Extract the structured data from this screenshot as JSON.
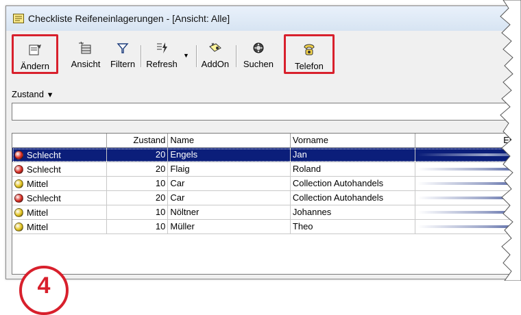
{
  "window": {
    "title": "Checkliste Reifeneinlagerungen  -  [Ansicht: Alle]"
  },
  "toolbar": {
    "aendern_label": "Ändern",
    "ansicht_label": "Ansicht",
    "filtern_label": "Filtern",
    "refresh_label": "Refresh",
    "addon_label": "AddOn",
    "suchen_label": "Suchen",
    "telefon_label": "Telefon"
  },
  "filter": {
    "zustand_label": "Zustand",
    "input_value": ""
  },
  "grid": {
    "columns": [
      "",
      "Zustand",
      "Name",
      "Vorname",
      "Ein"
    ],
    "rows": [
      {
        "status": "Schlecht",
        "status_color": "#d92a20",
        "zustand": "20",
        "name": "Engels",
        "vorname": "Jan",
        "selected": true
      },
      {
        "status": "Schlecht",
        "status_color": "#d92a20",
        "zustand": "20",
        "name": "Flaig",
        "vorname": "Roland",
        "selected": false
      },
      {
        "status": "Mittel",
        "status_color": "#e2c21a",
        "zustand": "10",
        "name": "Car",
        "vorname": "Collection Autohandels",
        "selected": false
      },
      {
        "status": "Schlecht",
        "status_color": "#d92a20",
        "zustand": "20",
        "name": "Car",
        "vorname": "Collection Autohandels",
        "selected": false
      },
      {
        "status": "Mittel",
        "status_color": "#e2c21a",
        "zustand": "10",
        "name": "Nöltner",
        "vorname": "Johannes",
        "selected": false
      },
      {
        "status": "Mittel",
        "status_color": "#e2c21a",
        "zustand": "10",
        "name": "Müller",
        "vorname": "Theo",
        "selected": false
      }
    ]
  },
  "annotation": {
    "step_number": "4",
    "highlight_color": "#d8202c"
  },
  "icons": [
    "notepad-icon",
    "edit-icon",
    "view-icon",
    "filter-icon",
    "refresh-icon",
    "addon-icon",
    "search-icon",
    "phone-icon"
  ]
}
